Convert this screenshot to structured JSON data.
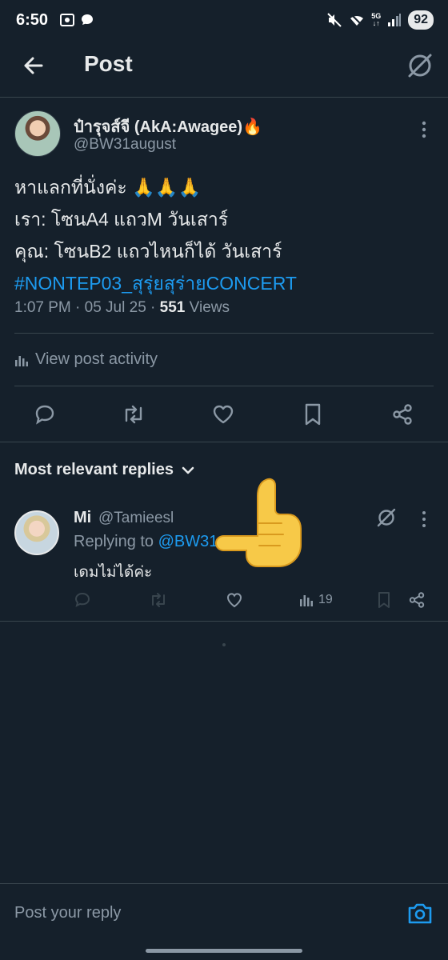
{
  "status_bar": {
    "time": "6:50",
    "network": "5G",
    "battery": "92"
  },
  "header": {
    "title": "Post"
  },
  "post": {
    "author_name": "ป๋ารุจส์จี (AkA:Awagee)🔥",
    "author_handle": "@BW31august",
    "text_lines": [
      "หาแลกที่นั่งค่ะ 🙏🙏🙏",
      "เรา: โซนA4 แถวM วันเสาร์",
      "คุณ: โซนB2 แถวไหนก็ได้ วันเสาร์"
    ],
    "hashtag": "#NONTEP03_สุรุ่ยสุร่ายCONCERT",
    "timestamp": "1:07 PM · 05 Jul 25 · ",
    "views_count": "551",
    "views_label": " Views",
    "activity_label": "View post activity"
  },
  "replies_section": {
    "title": "Most relevant replies"
  },
  "reply": {
    "name": "Mi",
    "handle": "@Tamieesl",
    "replying_to_prefix": "Replying to ",
    "replying_to_handle": "@BW31",
    "text": "เดมไม่ได้ค่ะ",
    "views": "19"
  },
  "composer": {
    "placeholder": "Post your reply"
  },
  "colors": {
    "background": "#15202b",
    "accent": "#1d9bf0",
    "muted": "#8b98a5",
    "divider": "#38444d"
  }
}
